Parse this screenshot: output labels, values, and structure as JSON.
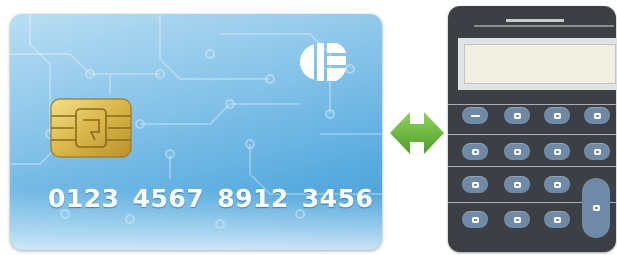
{
  "card": {
    "number_groups": [
      "0123",
      "4567",
      "8912",
      "3456"
    ],
    "chip_icon": "contact-chip-icon",
    "logo_icon": "globe-logo-icon"
  },
  "connector": {
    "icon": "double-headed-arrow-icon",
    "color": "#5aa832"
  },
  "calculator": {
    "body_color": "#3c3f43",
    "key_color": "#6f8aa6",
    "display_color": "#f1efe0",
    "rows": [
      [
        "minus",
        "key",
        "key",
        "key"
      ],
      [
        "key",
        "key",
        "key",
        "key"
      ],
      [
        "key",
        "key",
        "key"
      ],
      [
        "key",
        "key",
        "key"
      ]
    ],
    "tall_key": "key"
  }
}
